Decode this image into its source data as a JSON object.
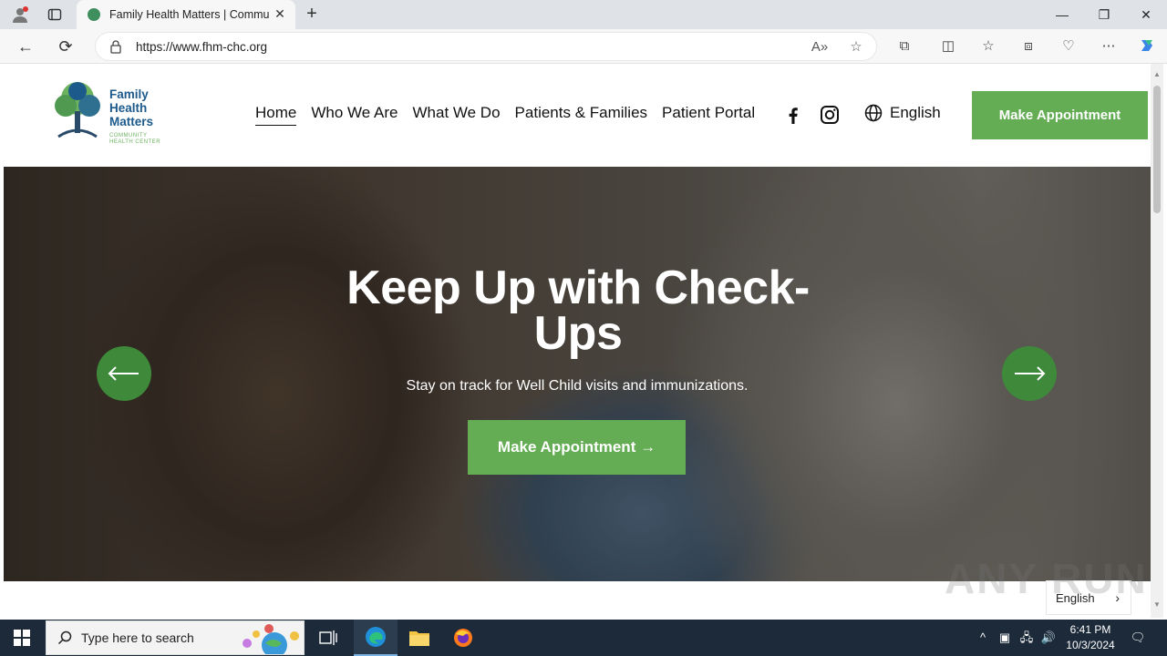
{
  "browser": {
    "tab_title": "Family Health Matters | Community",
    "url": "https://www.fhm-chc.org"
  },
  "site": {
    "logo_text": "Family\nHealth\nMatters",
    "logo_sub": "COMMUNITY\nHEALTH CENTER",
    "nav": [
      {
        "label": "Home",
        "active": true
      },
      {
        "label": "Who We Are"
      },
      {
        "label": "What We Do"
      },
      {
        "label": "Patients & Families"
      },
      {
        "label": "Patient Portal"
      }
    ],
    "language": "English",
    "appointment_button": "Make Appointment"
  },
  "hero": {
    "title": "Keep Up with Check-Ups",
    "subtitle": "Stay on track for Well Child visits and immunizations.",
    "cta": "Make Appointment →"
  },
  "language_picker": "English",
  "watermark": "ANY RUN",
  "taskbar": {
    "search_placeholder": "Type here to search",
    "time": "6:41 PM",
    "date": "10/3/2024"
  },
  "colors": {
    "accent_green": "#64ad55",
    "arrow_green": "#3e8a3a",
    "logo_blue": "#1d5a8c"
  }
}
